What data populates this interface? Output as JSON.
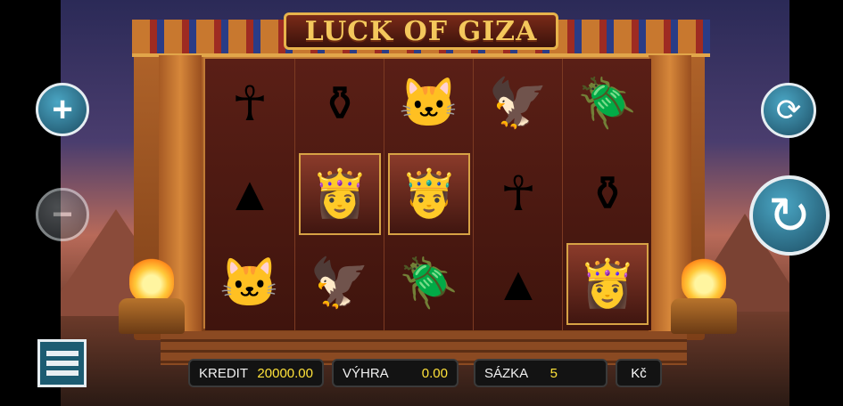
{
  "game": {
    "title": "LUCK OF GIZA"
  },
  "reels": [
    [
      "☥",
      "▲",
      "🐱"
    ],
    [
      "⚱",
      "👸",
      "🦅"
    ],
    [
      "🐱",
      "🤴",
      "🪲"
    ],
    [
      "🦅",
      "☥",
      "▲"
    ],
    [
      "🪲",
      "⚱",
      "👸"
    ]
  ],
  "controls": {
    "plus_icon": "+",
    "minus_icon": "−",
    "autoplay_icon": "⟳",
    "spin_icon": "↻"
  },
  "status_bar": {
    "kredit_label": "KREDIT",
    "kredit_value": "20000.00",
    "vyhra_label": "VÝHRA",
    "vyhra_value": "0.00",
    "sazka_label": "SÁZKA",
    "sazka_value": "5",
    "currency": "Kč"
  }
}
